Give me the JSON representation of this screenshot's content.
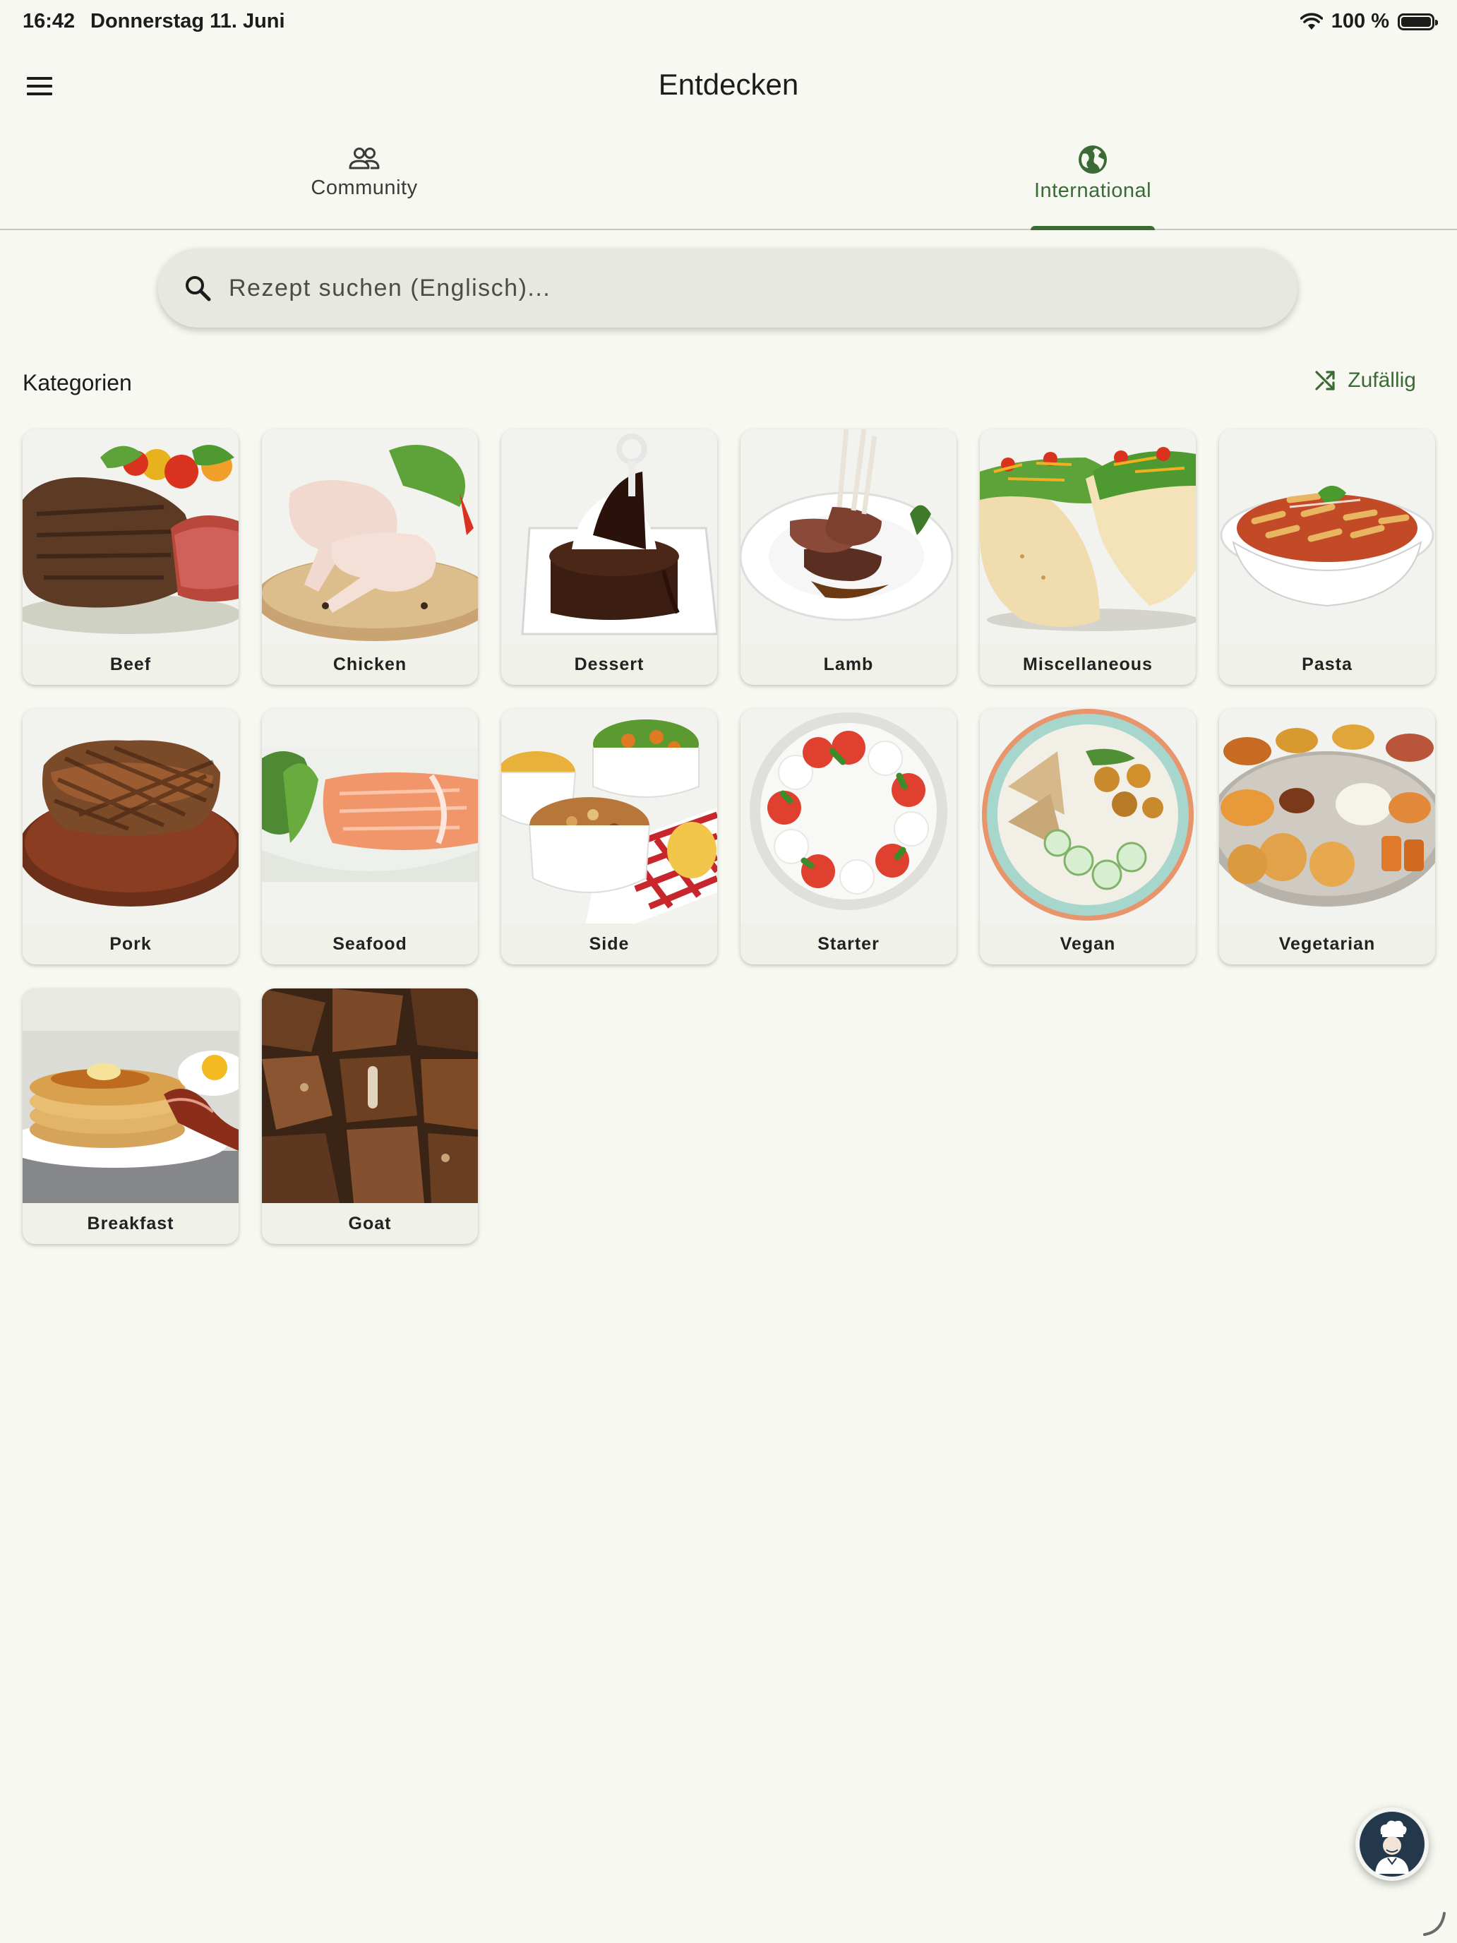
{
  "status_bar": {
    "time": "16:42",
    "date": "Donnerstag 11. Juni",
    "battery": "100 %"
  },
  "app_bar": {
    "title": "Entdecken",
    "menu_icon": "hamburger-menu-icon"
  },
  "tabs": [
    {
      "label": "Community",
      "icon": "people-icon",
      "active": false
    },
    {
      "label": "International",
      "icon": "globe-icon",
      "active": true
    }
  ],
  "search": {
    "placeholder": "Rezept suchen (Englisch)...",
    "value": ""
  },
  "categories_section": {
    "title": "Kategorien",
    "random_label": "Zufällig",
    "random_icon": "shuffle-icon"
  },
  "categories": [
    {
      "label": "Beef",
      "icon": "steak-image"
    },
    {
      "label": "Chicken",
      "icon": "chicken-legs-image"
    },
    {
      "label": "Dessert",
      "icon": "chocolate-cake-image"
    },
    {
      "label": "Lamb",
      "icon": "lamb-chops-image"
    },
    {
      "label": "Miscellaneous",
      "icon": "tacos-image"
    },
    {
      "label": "Pasta",
      "icon": "penne-image"
    },
    {
      "label": "Pork",
      "icon": "pork-chop-image"
    },
    {
      "label": "Seafood",
      "icon": "salmon-image"
    },
    {
      "label": "Side",
      "icon": "side-dishes-image"
    },
    {
      "label": "Starter",
      "icon": "caprese-image"
    },
    {
      "label": "Vegan",
      "icon": "vegan-bowl-image"
    },
    {
      "label": "Vegetarian",
      "icon": "thali-image"
    },
    {
      "label": "Breakfast",
      "icon": "pancakes-image"
    },
    {
      "label": "Goat",
      "icon": "goat-meat-image"
    }
  ],
  "colors": {
    "background": "#f6f8f1",
    "accent": "#3b6b35",
    "card": "#f0f2ea",
    "search": "#e7e9e1"
  },
  "fab": {
    "icon": "chef-avatar-icon"
  }
}
